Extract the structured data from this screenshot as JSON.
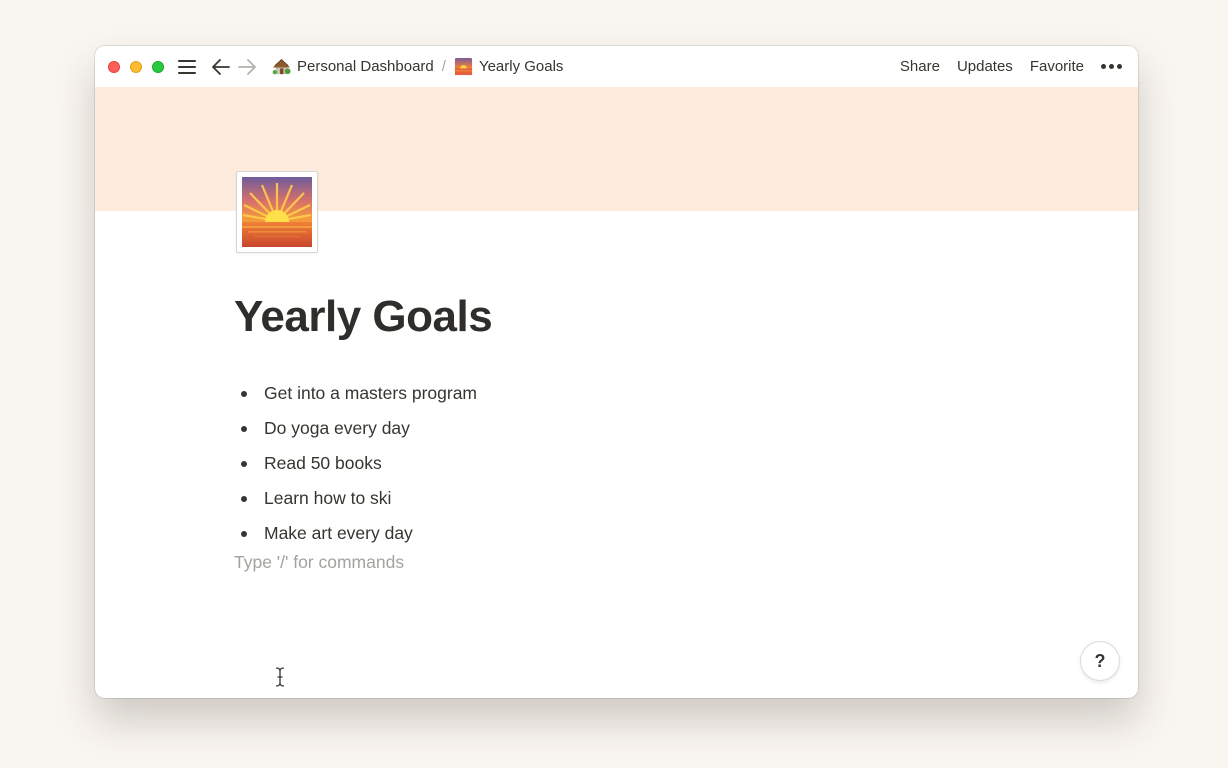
{
  "topbar": {
    "breadcrumbs": [
      {
        "label": "Personal Dashboard",
        "icon": "hut-emoji-icon"
      },
      {
        "label": "Yearly Goals",
        "icon": "sunrise-emoji-icon"
      }
    ],
    "separator": "/",
    "actions": {
      "share": "Share",
      "updates": "Updates",
      "favorite": "Favorite"
    }
  },
  "page": {
    "title": "Yearly Goals",
    "icon": "sunrise-emoji-icon",
    "cover_color": "#fdebdd",
    "bullets": [
      "Get into a masters program",
      "Do yoga every day",
      "Read 50 books",
      "Learn how to ski",
      "Make art every day"
    ],
    "placeholder": "Type '/' for commands"
  },
  "help": {
    "label": "?"
  },
  "colors": {
    "traffic_red": "#fe5f57",
    "traffic_yellow": "#febc2e",
    "traffic_green": "#28c840"
  }
}
